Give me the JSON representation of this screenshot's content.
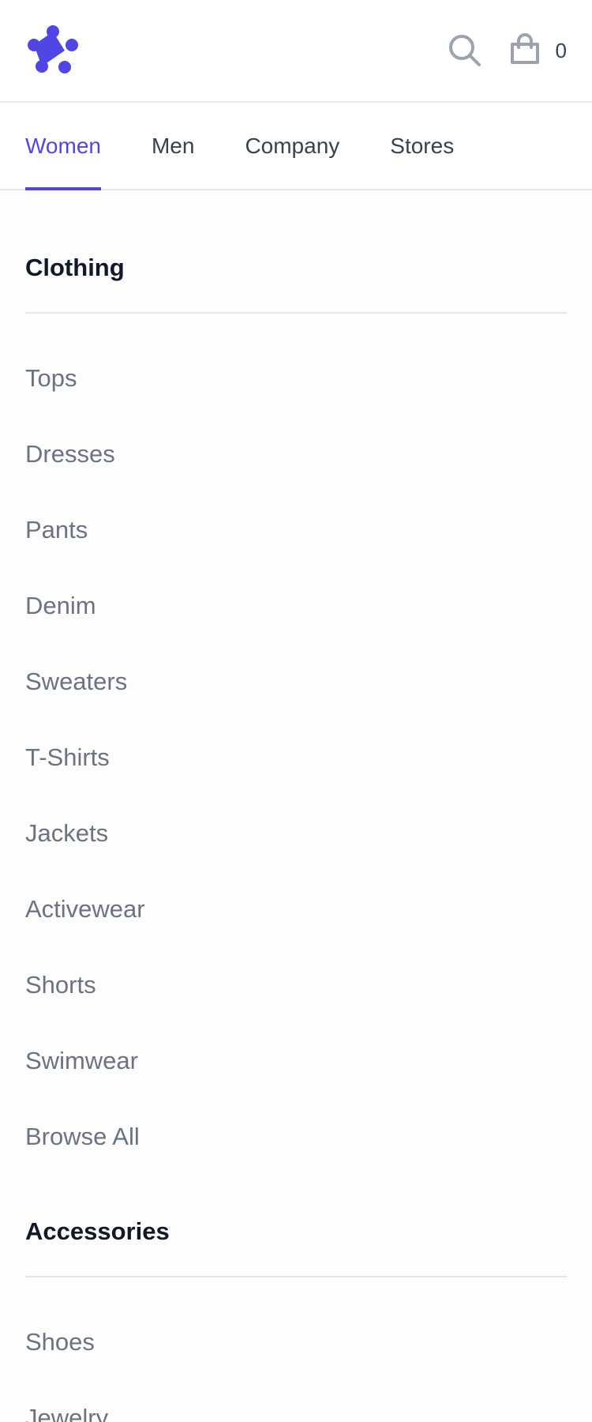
{
  "brand": {
    "logo_icon": "brand-logo-icon",
    "accent_color": "#4f46e5"
  },
  "header": {
    "search_icon": "search-icon",
    "cart_icon": "shopping-bag-icon",
    "cart_count": "0"
  },
  "tabs": [
    {
      "label": "Women",
      "active": true
    },
    {
      "label": "Men",
      "active": false
    },
    {
      "label": "Company",
      "active": false
    },
    {
      "label": "Stores",
      "active": false
    }
  ],
  "sections": {
    "clothing": {
      "title": "Clothing",
      "items": [
        "Tops",
        "Dresses",
        "Pants",
        "Denim",
        "Sweaters",
        "T-Shirts",
        "Jackets",
        "Activewear",
        "Shorts",
        "Swimwear",
        "Browse All"
      ]
    },
    "accessories": {
      "title": "Accessories",
      "items": [
        "Shoes",
        "Jewelry"
      ]
    }
  }
}
